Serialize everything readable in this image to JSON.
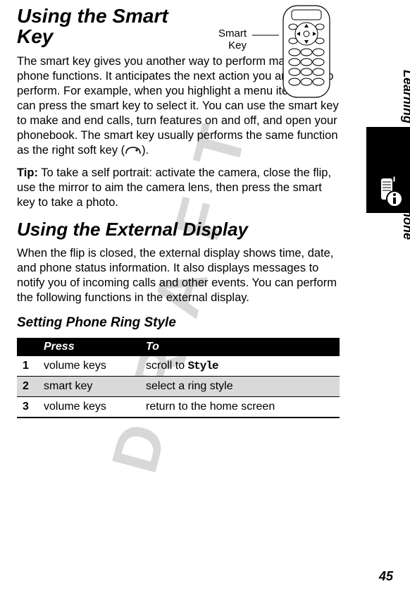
{
  "watermark": "D R A F T",
  "headings": {
    "h1": "Using the Smart Key",
    "h2": "Using the External Display",
    "h3": "Setting Phone Ring Style"
  },
  "figure": {
    "label_line1": "Smart",
    "label_line2": "Key"
  },
  "paragraphs": {
    "p1": "The smart key gives you another way to perform many basic phone functions. It anticipates the next action you are likely to perform. For example, when you highlight a menu item, you can press the smart key to select it. You can use the smart key to make and end calls, turn features on and off, and open your phonebook. The smart key usually performs the same function as the right soft key (",
    "p1_end": ").",
    "tip_label": "Tip:",
    "p2": " To take a self portrait: activate the camera, close the flip, use the mirror to aim the camera lens, then press the smart key to take a photo.",
    "p3": "When the flip is closed, the external display shows time, date, and phone status information. It also displays messages to notify you of incoming calls and other events. You can perform the following functions in the external display."
  },
  "table": {
    "head": {
      "press": "Press",
      "to": "To"
    },
    "rows": [
      {
        "n": "1",
        "press": "volume keys",
        "to_prefix": "scroll to ",
        "to_value": "Style",
        "shade": false
      },
      {
        "n": "2",
        "press": "smart key",
        "to_prefix": "",
        "to_value": "select a ring style",
        "shade": true
      },
      {
        "n": "3",
        "press": "volume keys",
        "to_prefix": "",
        "to_value": "return to the home screen",
        "shade": false
      }
    ]
  },
  "rail": {
    "vertical_title": "Learning to Use Your Phone"
  },
  "page_number": "45"
}
